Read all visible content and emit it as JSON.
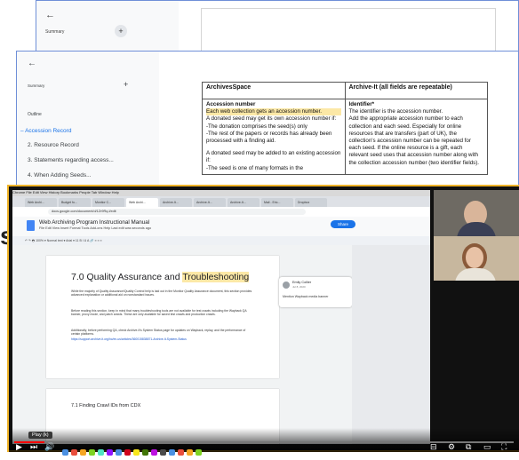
{
  "back_window": {
    "summary_label": "Summary",
    "plus": "+",
    "back_arrow": "←"
  },
  "mid_window": {
    "back_arrow": "←",
    "summary_label": "Summary",
    "plus": "+",
    "outline_label": "Outline",
    "outline_items": [
      "Accession Record",
      "2. Resource Record",
      "3. Statements regarding access...",
      "4. When Adding Seeds..."
    ],
    "table": {
      "col1_header": "ArchivesSpace",
      "col2_header": "Archive-It (all fields are repeatable)",
      "col1_title": "Accession number",
      "col1_lines": [
        "Each web collection gets an accession number.",
        "A donated seed may get its own accession number if:",
        "-The donation comprises the seed(s) only",
        "-The rest of the papers or records has already been processed with a finding aid.",
        "",
        "A donated seed may be added to an existing accession if:",
        "-The seed is one of many formats in the"
      ],
      "col2_title": "Identifier*",
      "col2_lines": [
        "The identifier is the accession number.",
        "Add the appropriate accession number to each collection and each seed. Especially for online resources that are transfers (part of UK), the collection's accession number can be repeated for each seed. If the online resource is a gift, each relevant seed uses that accession number along with the collection accession number (two identifier fields)."
      ]
    }
  },
  "video": {
    "mac_bar": "Chrome  File  Edit  View  History  Bookmarks  People  Tab  Window  Help",
    "browser_tabs": [
      "Web Archi...",
      "Budget fo...",
      "Monitor C...",
      "Web Archi...",
      "Archive-It...",
      "Archive-It...",
      "Archive-It...",
      "Mail - Eric...",
      "Dropbox"
    ],
    "address": "docs.google.com/document/d/1Zr9Rq-l/edit",
    "doc_title": "Web Archiving Program Instructional Manual",
    "doc_menu": "File  Edit  View  Insert  Format  Tools  Add-ons  Help   Last edit was seconds ago",
    "share_label": "Share",
    "toolbar_text": "↶ ↷ 🖶   100%  ▾   Normal text  ▾   Arial  ▾   11   B  I  U  A   🔗  ≡  ≡  ≡",
    "heading_pre": "7.0 Quality Assurance and ",
    "heading_hl": "Troubleshooting",
    "para1": "While the majority of Quality Assurance/Quality Control help is laid out in the Monitor Quality Assurance document, this section provides advanced explanation or additional aid on nonstandard issues.",
    "para2": "Before reading this section, keep in mind that many troubleshooting tools are not available for test crawls including the Wayback QA banner, proxy mode, and patch crawls. These are only available for saved test crawls and production crawls.",
    "para3": "Additionally, before performing QA, check Archive-It's System Status page for updates on Wayback, replay, and the performance of certain platforms.",
    "link": "https://support.archive-it.org/hc/en-us/articles/360015838871-Archive-It-System-Status",
    "comment_name": "Emily Collier",
    "comment_date": "Jul 8, 2020",
    "comment_text": "Mention Wayback media banner",
    "section_heading": "7.1 Finding Crawl IDs from CDX",
    "play_tooltip": "Play (k)"
  },
  "colors": {
    "window_border": "#6f8fd8",
    "highlight": "#fce8a6",
    "link_blue": "#1a73e8",
    "video_border": "#f0b429",
    "progress_red": "#ff0000"
  },
  "playback": {
    "progress_fraction": 0.06
  },
  "cut_letter": "s"
}
